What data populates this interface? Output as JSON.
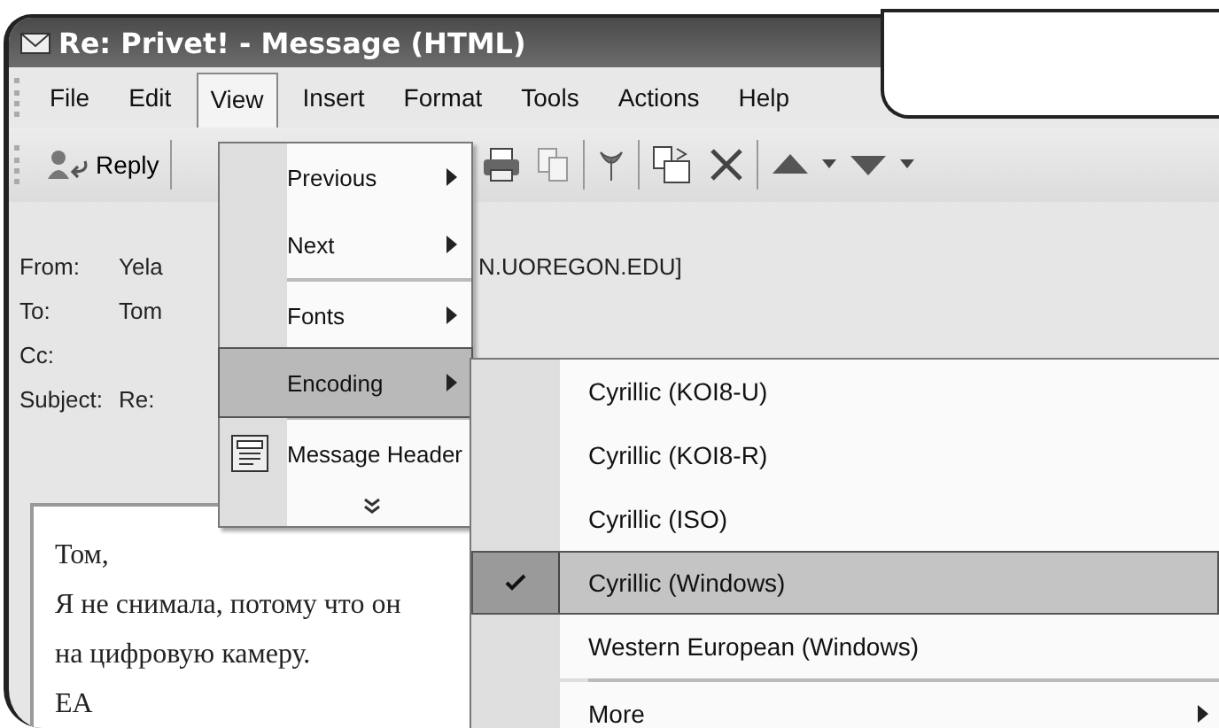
{
  "window": {
    "title": "Re: Privet! - Message (HTML)"
  },
  "menu_bar": [
    {
      "label": "File",
      "selected": false
    },
    {
      "label": "Edit",
      "selected": false
    },
    {
      "label": "View",
      "selected": true
    },
    {
      "label": "Insert",
      "selected": false
    },
    {
      "label": "Format",
      "selected": false
    },
    {
      "label": "Tools",
      "selected": false
    },
    {
      "label": "Actions",
      "selected": false
    },
    {
      "label": "Help",
      "selected": false
    }
  ],
  "toolbar": {
    "reply_label": "Reply"
  },
  "header": [
    {
      "label": "From:",
      "value": "Yela",
      "value_tail": "N.UOREGON.EDU]"
    },
    {
      "label": "To:",
      "value": "Tom"
    },
    {
      "label": "Cc:"
    },
    {
      "label": "Subject:",
      "value": "Re:"
    }
  ],
  "body": {
    "lines": [
      "Том,",
      "Я не снимала, потому что он",
      "на цифровую камеру.",
      "ЕА"
    ]
  },
  "view_menu": {
    "items": [
      {
        "kind": "item",
        "label": "Previous",
        "submenu": true,
        "selected": false
      },
      {
        "kind": "item",
        "label": "Next",
        "submenu": true,
        "selected": false
      },
      {
        "kind": "separator"
      },
      {
        "kind": "item",
        "label": "Fonts",
        "submenu": true,
        "selected": false
      },
      {
        "kind": "item",
        "label": "Encoding",
        "submenu": true,
        "selected": true
      },
      {
        "kind": "separator"
      },
      {
        "kind": "item",
        "label": "Message Header",
        "icon": true,
        "selected": false
      },
      {
        "kind": "expand"
      }
    ]
  },
  "encoding_menu": {
    "items": [
      {
        "kind": "item",
        "label": "Cyrillic (KOI8-U)",
        "checked": false,
        "selected": false
      },
      {
        "kind": "item",
        "label": "Cyrillic (KOI8-R)",
        "checked": false,
        "selected": false
      },
      {
        "kind": "item",
        "label": "Cyrillic (ISO)",
        "checked": false,
        "selected": false
      },
      {
        "kind": "item",
        "label": "Cyrillic (Windows)",
        "checked": true,
        "selected": true
      },
      {
        "kind": "item",
        "label": "Western European (Windows)",
        "checked": false,
        "selected": false
      },
      {
        "kind": "separator"
      },
      {
        "kind": "item",
        "label": "More",
        "submenu": true,
        "checked": false,
        "selected": false
      }
    ]
  }
}
